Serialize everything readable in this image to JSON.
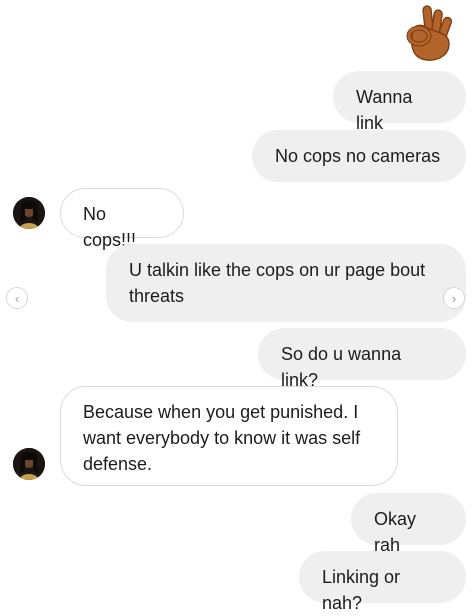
{
  "thread": {
    "reaction_emoji": "ok-hand-emoji",
    "messages": [
      {
        "sender": "me",
        "text": "Wanna link"
      },
      {
        "sender": "me",
        "text": "No cops no cameras"
      },
      {
        "sender": "them",
        "text": "No cops!!!"
      },
      {
        "sender": "me",
        "text": "U talkin like the cops on ur page bout threats"
      },
      {
        "sender": "me",
        "text": "So do u wanna link?"
      },
      {
        "sender": "them",
        "text": "Because when you get punished. I want everybody to know it was self defense."
      },
      {
        "sender": "me",
        "text": "Okay rah"
      },
      {
        "sender": "me",
        "text": "Linking or nah?"
      }
    ]
  },
  "nav": {
    "prev_glyph": "‹",
    "next_glyph": "›"
  },
  "colors": {
    "outgoing_bubble": "#efefef",
    "incoming_border": "#dbdbdb",
    "text": "#1c1c1c"
  }
}
